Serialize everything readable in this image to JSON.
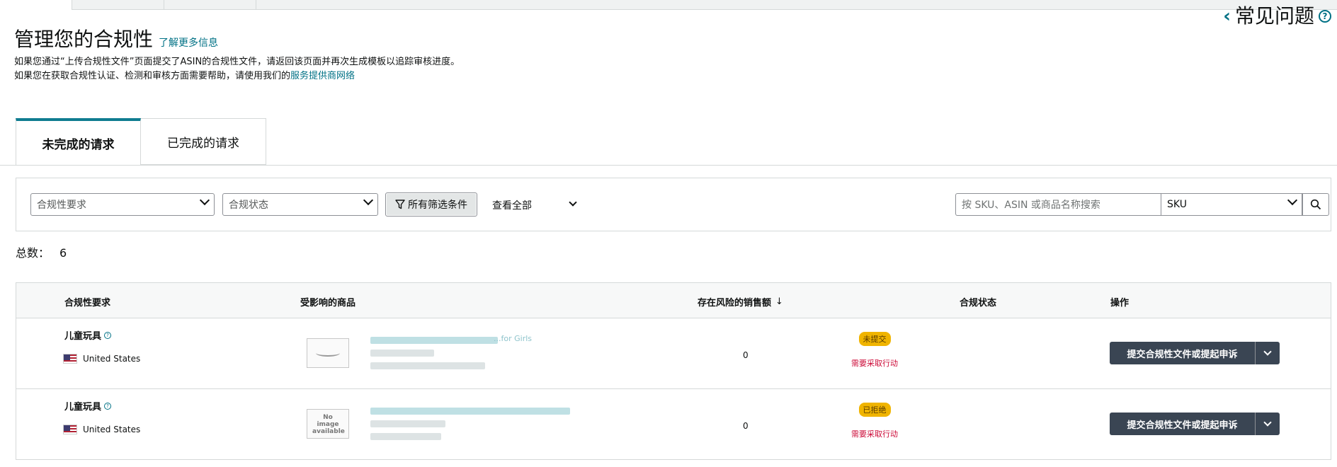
{
  "faq": {
    "label": "常见问题"
  },
  "page": {
    "title": "管理您的合规性",
    "learn_more": "了解更多信息",
    "desc_line1": "如果您通过“上传合规性文件”页面提交了ASIN的合规性文件，请返回该页面并再次生成模板以追踪审核进度。",
    "desc_line2_prefix": "如果您在获取合规性认证、检测和审核方面需要帮助，请使用我们的",
    "desc_line2_link": "服务提供商网络"
  },
  "tabs": [
    {
      "label": "未完成的请求"
    },
    {
      "label": "已完成的请求"
    }
  ],
  "filters": {
    "requirement_placeholder": "合规性要求",
    "status_placeholder": "合规状态",
    "all_filters": "所有筛选条件",
    "view_all": "查看全部",
    "search_placeholder": "按 SKU、ASIN 或商品名称搜索",
    "search_type": "SKU"
  },
  "total": {
    "label": "总数：",
    "value": "6"
  },
  "table": {
    "headers": {
      "requirement": "合规性要求",
      "affected": "受影响的商品",
      "sales_at_risk": "存在风险的销售额",
      "status": "合规状态",
      "actions": "操作"
    },
    "rows": [
      {
        "requirement": "儿童玩具",
        "country": "United States",
        "product_fragment": "...for Girls",
        "sales": "0",
        "status_badge": "未提交",
        "action_needed": "需要采取行动",
        "action_label": "提交合规性文件或提起申诉"
      },
      {
        "requirement": "儿童玩具",
        "country": "United States",
        "thumb_text": "No image available",
        "sales": "0",
        "status_badge": "已拒绝",
        "action_needed": "需要采取行动",
        "action_label": "提交合规性文件或提起申诉"
      }
    ]
  }
}
